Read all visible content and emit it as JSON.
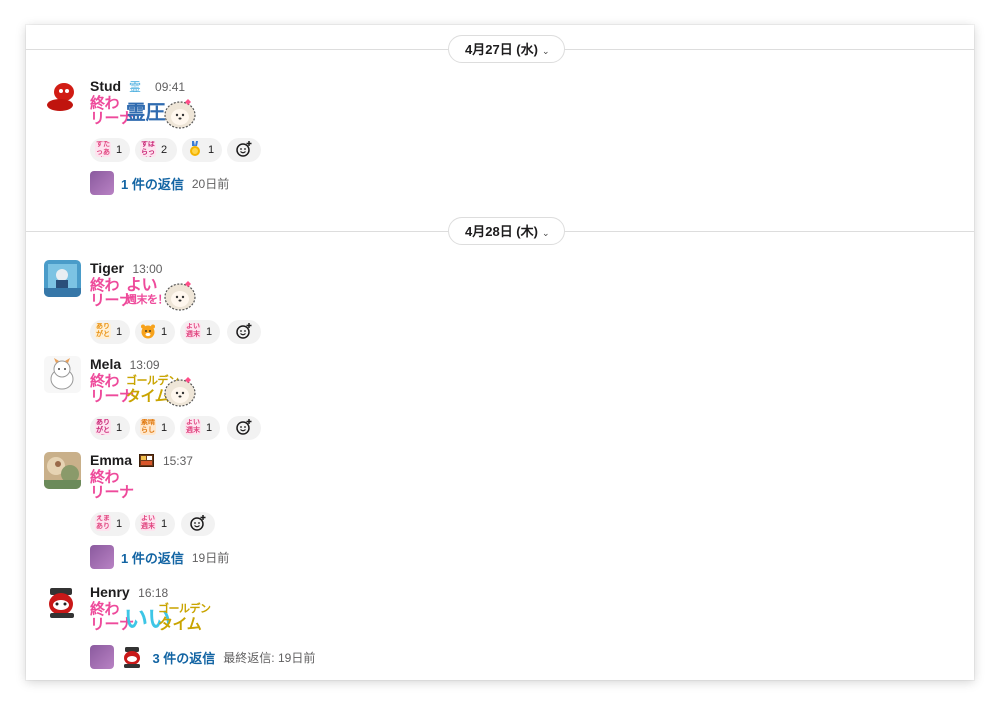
{
  "dates": {
    "first": "4月27日 (水)",
    "second": "4月28日 (木)"
  },
  "messages": [
    {
      "name": "Stud",
      "time": "09:41",
      "sticker_top": "終わ",
      "sticker_bottom": "リーナ",
      "sticker_extra": "霊圧",
      "reactions": [
        {
          "emoji": "すたっあり",
          "count": "1"
        },
        {
          "emoji": "すばらっど",
          "count": "2"
        },
        {
          "emoji": "medal-icon",
          "count": "1"
        }
      ],
      "thread": {
        "link": "1 件の返信",
        "meta": "20日前"
      }
    },
    {
      "name": "Tiger",
      "time": "13:00",
      "sticker_top": "終わ",
      "sticker_bottom": "リーナ",
      "sticker_extra_top": "よい",
      "sticker_extra_bottom": "週末を！",
      "reactions": [
        {
          "emoji": "ありがとい",
          "count": "1"
        },
        {
          "emoji": "tiger-icon",
          "count": "1"
        },
        {
          "emoji": "よい週末",
          "count": "1"
        }
      ]
    },
    {
      "name": "Mela",
      "time": "13:09",
      "sticker_top": "終わ",
      "sticker_bottom": "リーナ",
      "sticker_extra_top": "ゴールデン",
      "sticker_extra_bottom": "タイム",
      "reactions": [
        {
          "emoji": "ありがとう",
          "count": "1"
        },
        {
          "emoji": "素晴らしい",
          "count": "1"
        },
        {
          "emoji": "よい週末",
          "count": "1"
        }
      ]
    },
    {
      "name": "Emma",
      "time": "15:37",
      "sticker_top": "終わ",
      "sticker_bottom": "リーナ",
      "reactions": [
        {
          "emoji": "えまあり",
          "count": "1"
        },
        {
          "emoji": "よい週末",
          "count": "1"
        }
      ],
      "thread": {
        "link": "1 件の返信",
        "meta": "19日前"
      }
    },
    {
      "name": "Henry",
      "time": "16:18",
      "sticker_top": "終わ",
      "sticker_bottom": "リーナ",
      "sticker_extra_big": "いい",
      "sticker_extra_top": "ゴールデン",
      "sticker_extra_bottom": "タイム",
      "thread": {
        "link": "3 件の返信",
        "meta": "最終返信: 19日前"
      }
    }
  ],
  "colors": {
    "link": "#1264a3",
    "sticker_pink": "#ee4a9b",
    "pill_bg": "#f2f2f2"
  }
}
